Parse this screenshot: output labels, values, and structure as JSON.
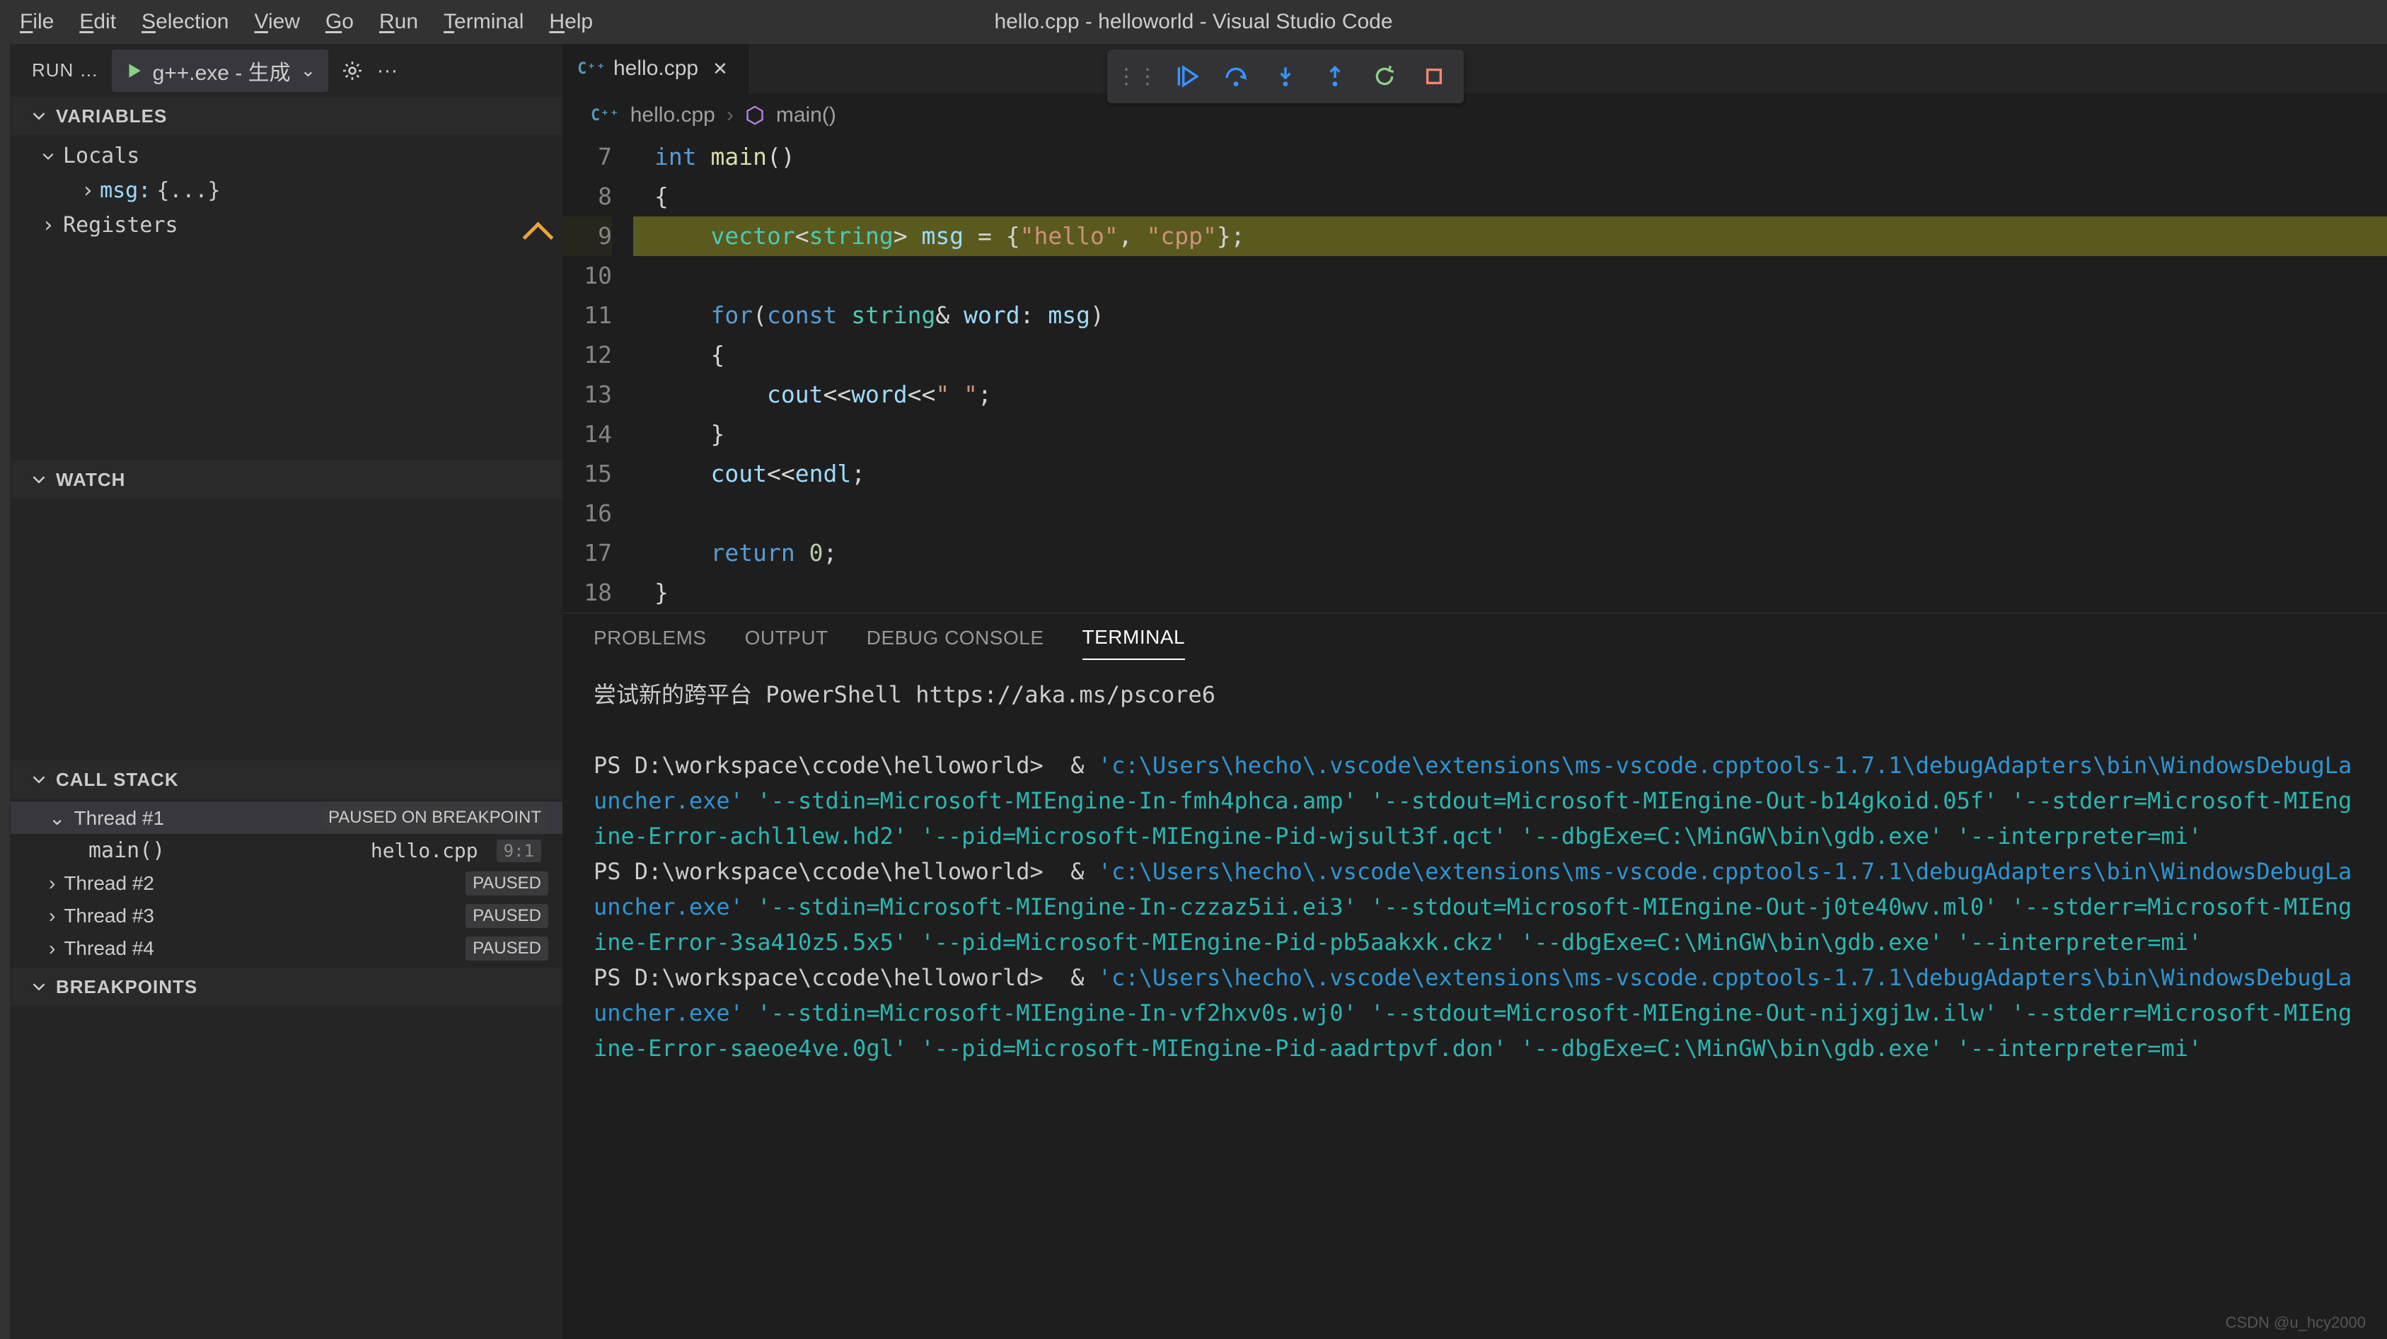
{
  "title": "hello.cpp - helloworld - Visual Studio Code",
  "menu": {
    "items": [
      "File",
      "Edit",
      "Selection",
      "View",
      "Go",
      "Run",
      "Terminal",
      "Help"
    ]
  },
  "run": {
    "label": "RUN …",
    "config": "g++.exe - 生成"
  },
  "variables": {
    "header": "VARIABLES",
    "scopes": [
      {
        "name": "Locals",
        "expanded": true,
        "vars": [
          {
            "name": "msg:",
            "value": "{...}",
            "expandable": true
          }
        ]
      },
      {
        "name": "Registers",
        "expanded": false
      }
    ]
  },
  "watch": {
    "header": "WATCH"
  },
  "callstack": {
    "header": "CALL STACK",
    "threads": [
      {
        "name": "Thread #1",
        "status": "PAUSED ON BREAKPOINT",
        "expanded": true,
        "frames": [
          {
            "fn": "main()",
            "file": "hello.cpp",
            "pos": "9:1"
          }
        ]
      },
      {
        "name": "Thread #2",
        "status": "PAUSED",
        "expanded": false
      },
      {
        "name": "Thread #3",
        "status": "PAUSED",
        "expanded": false
      },
      {
        "name": "Thread #4",
        "status": "PAUSED",
        "expanded": false
      }
    ]
  },
  "breakpoints": {
    "header": "BREAKPOINTS"
  },
  "tab": {
    "file": "hello.cpp"
  },
  "breadcrumb": {
    "file": "hello.cpp",
    "symbol": "main()"
  },
  "code": {
    "start": 7,
    "current": 9,
    "lines": [
      {
        "n": 7,
        "html": "<span class='kw'>int</span> <span class='fn'>main</span><span class='pl'>()</span>"
      },
      {
        "n": 8,
        "html": "<span class='pl'>{</span>"
      },
      {
        "n": 9,
        "html": "    <span class='ty'>vector</span><span class='pl'>&lt;</span><span class='ty'>string</span><span class='pl'>&gt;</span> <span class='va'>msg</span> <span class='pl'>= {</span><span class='st'>\"hello\"</span><span class='pl'>, </span><span class='st'>\"cpp\"</span><span class='pl'>};</span>"
      },
      {
        "n": 10,
        "html": ""
      },
      {
        "n": 11,
        "html": "    <span class='kw'>for</span><span class='pl'>(</span><span class='kw'>const</span> <span class='ty'>string</span><span class='pl'>&amp; </span><span class='va'>word</span><span class='pl'>: </span><span class='va'>msg</span><span class='pl'>)</span>"
      },
      {
        "n": 12,
        "html": "    <span class='pl'>{</span>"
      },
      {
        "n": 13,
        "html": "        <span class='va'>cout</span><span class='pl'>&lt;&lt;</span><span class='va'>word</span><span class='pl'>&lt;&lt;</span><span class='st'>\" \"</span><span class='pl'>;</span>"
      },
      {
        "n": 14,
        "html": "    <span class='pl'>}</span>"
      },
      {
        "n": 15,
        "html": "    <span class='va'>cout</span><span class='pl'>&lt;&lt;</span><span class='va'>endl</span><span class='pl'>;</span>"
      },
      {
        "n": 16,
        "html": ""
      },
      {
        "n": 17,
        "html": "    <span class='kw'>return</span> <span class='nu'>0</span><span class='pl'>;</span>"
      },
      {
        "n": 18,
        "html": "<span class='pl'>}</span>"
      }
    ]
  },
  "panel": {
    "tabs": [
      "PROBLEMS",
      "OUTPUT",
      "DEBUG CONSOLE",
      "TERMINAL"
    ],
    "active": 3
  },
  "terminal": {
    "intro": "尝试新的跨平台 PowerShell https://aka.ms/pscore6",
    "prompt": "PS D:\\workspace\\ccode\\helloworld> ",
    "amp": "&",
    "exe": "'c:\\Users\\hecho\\.vscode\\extensions\\ms-vscode.cpptools-1.7.1\\debugAdapters\\bin\\WindowsDebugLauncher.exe'",
    "tail_a": " '--dbgExe=C:\\MinGW\\bin\\gdb.exe' '--interpreter=mi'",
    "runs": [
      {
        "args": " '--stdin=Microsoft-MIEngine-In-fmh4phca.amp' '--stdout=Microsoft-MIEngine-Out-b14gkoid.05f' '--stderr=Microsoft-MIEngine-Error-achl1lew.hd2' '--pid=Microsoft-MIEngine-Pid-wjsult3f.qct'"
      },
      {
        "args": " '--stdin=Microsoft-MIEngine-In-czzaz5ii.ei3' '--stdout=Microsoft-MIEngine-Out-j0te40wv.ml0' '--stderr=Microsoft-MIEngine-Error-3sa410z5.5x5' '--pid=Microsoft-MIEngine-Pid-pb5aakxk.ckz'"
      },
      {
        "args": " '--stdin=Microsoft-MIEngine-In-vf2hxv0s.wj0' '--stdout=Microsoft-MIEngine-Out-nijxgj1w.ilw' '--stderr=Microsoft-MIEngine-Error-saeoe4ve.0gl' '--pid=Microsoft-MIEngine-Pid-aadrtpvf.don'"
      }
    ]
  },
  "watermark": "CSDN @u_hcy2000"
}
